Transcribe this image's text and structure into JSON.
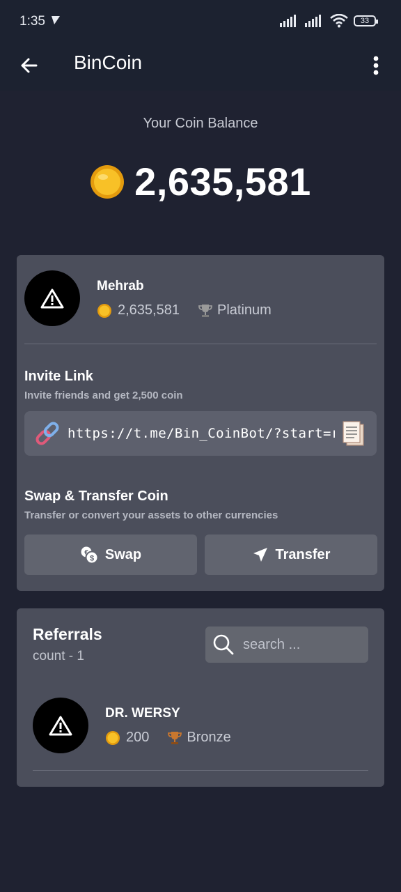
{
  "status_bar": {
    "time": "1:35",
    "battery": "33"
  },
  "app_bar": {
    "title": "BinCoin"
  },
  "balance": {
    "label": "Your Coin Balance",
    "value": "2,635,581"
  },
  "profile": {
    "name": "Mehrab",
    "coins": "2,635,581",
    "rank": "Platinum"
  },
  "invite": {
    "title": "Invite Link",
    "subtitle": "Invite friends and get 2,500 coin",
    "link": "https://t.me/Bin_CoinBot/?start=ref_"
  },
  "swap_transfer": {
    "title": "Swap & Transfer Coin",
    "subtitle": "Transfer or convert your assets to other currencies",
    "swap_label": "Swap",
    "transfer_label": "Transfer"
  },
  "referrals": {
    "title": "Referrals",
    "count": "count - 1",
    "search_placeholder": "search ...",
    "items": [
      {
        "name": "DR. WERSY",
        "coins": "200",
        "rank": "Bronze"
      }
    ]
  },
  "colors": {
    "background": "#1f2231",
    "card": "#4b4e5b",
    "coin_gold": "#f4b61a",
    "trophy_bronze": "#c9772e",
    "trophy_platinum": "#9a9a9a"
  },
  "icons": [
    "back-arrow-icon",
    "more-vert-icon",
    "coin-icon",
    "trophy-icon",
    "link-icon",
    "copy-icon",
    "swap-icon",
    "send-icon",
    "search-icon",
    "warning-icon"
  ]
}
